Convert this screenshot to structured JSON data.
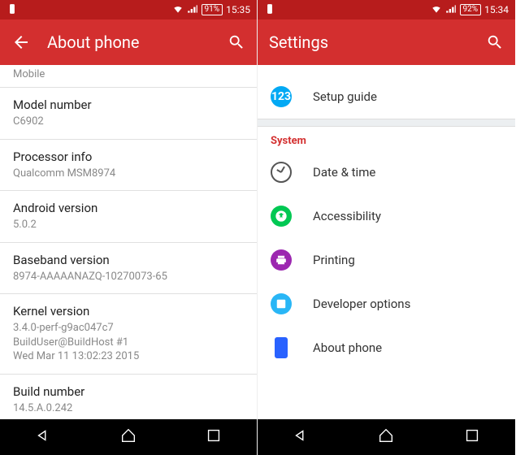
{
  "left": {
    "status": {
      "battery": "91%",
      "time": "15:35"
    },
    "appbar": {
      "title": "About phone"
    },
    "truncated": "Mobile",
    "items": [
      {
        "label": "Model number",
        "value": "C6902"
      },
      {
        "label": "Processor info",
        "value": "Qualcomm MSM8974"
      },
      {
        "label": "Android version",
        "value": "5.0.2"
      },
      {
        "label": "Baseband version",
        "value": "8974-AAAAANAZQ-10270073-65"
      },
      {
        "label": "Kernel version",
        "value": "3.4.0-perf-g9ac047c7\nBuildUser@BuildHost #1\nWed Mar 11 13:02:23 2015"
      },
      {
        "label": "Build number",
        "value": "14.5.A.0.242"
      }
    ]
  },
  "right": {
    "status": {
      "battery": "92%",
      "time": "15:34"
    },
    "appbar": {
      "title": "Settings"
    },
    "setup": "Setup guide",
    "section": "System",
    "rows": [
      {
        "label": "Date & time"
      },
      {
        "label": "Accessibility"
      },
      {
        "label": "Printing"
      },
      {
        "label": "Developer options"
      },
      {
        "label": "About phone"
      }
    ]
  }
}
